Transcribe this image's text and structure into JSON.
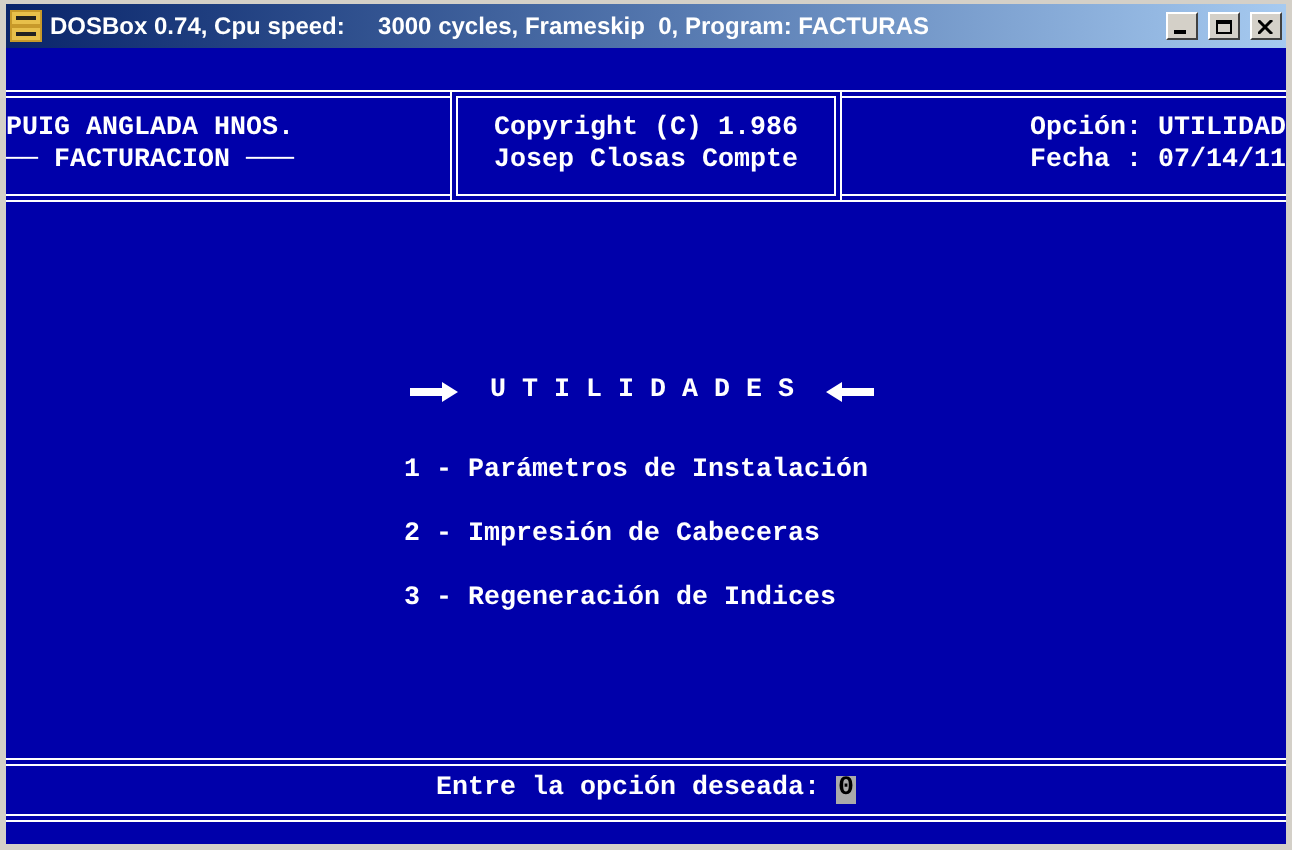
{
  "window": {
    "title": "DOSBox 0.74, Cpu speed:     3000 cycles, Frameskip  0, Program: FACTURAS"
  },
  "header": {
    "left": [
      "PUIG ANGLADA HNOS.",
      "── FACTURACION ───"
    ],
    "center": [
      "Copyright (C) 1.986",
      "Josep Closas Compte"
    ],
    "right": [
      "Opción: UTILIDAD",
      "Fecha : 07/14/11"
    ]
  },
  "menu": {
    "title": "U T I L I D A D E S",
    "items": [
      "1 - Parámetros de Instalación",
      "2 - Impresión de Cabeceras",
      "3 - Regeneración de Indices"
    ]
  },
  "prompt": {
    "label": "Entre la opción deseada:",
    "value": "0"
  }
}
